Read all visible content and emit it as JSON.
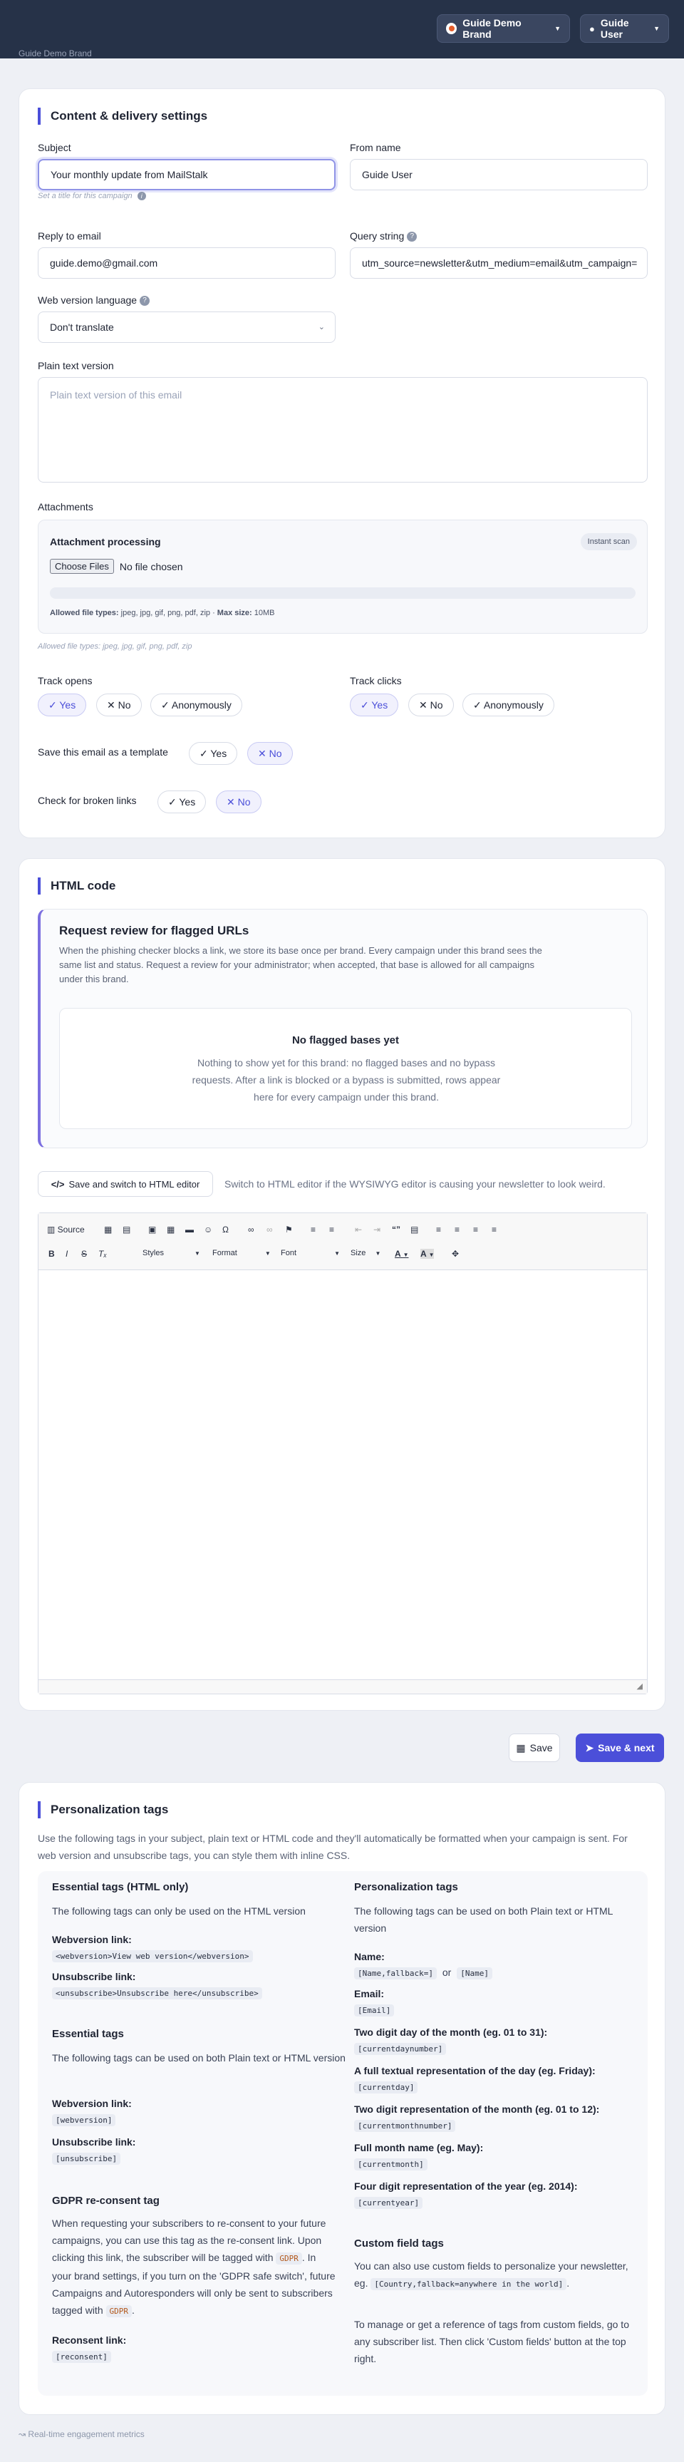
{
  "header": {
    "brand_button": "Guide Demo Brand",
    "user_button": "Guide User",
    "breadcrumb": "Guide Demo Brand"
  },
  "content_settings": {
    "title": "Content & delivery settings",
    "subject_label": "Subject",
    "subject_value": "Your monthly update from MailStalk",
    "subject_help": "Set a title for this campaign",
    "from_name_label": "From name",
    "from_name_value": "Guide User",
    "reply_to_label": "Reply to email",
    "reply_to_value": "guide.demo@gmail.com",
    "query_string_label": "Query string",
    "query_string_value": "utm_source=newsletter&utm_medium=email&utm_campaign=",
    "web_version_label": "Web version language",
    "web_version_value": "Don't translate",
    "plain_text_label": "Plain text version",
    "plain_text_placeholder": "Plain text version of this email",
    "attachments_label": "Attachments",
    "attachment_processing": "Attachment processing",
    "instant_scan": "Instant scan",
    "choose_files": "Choose Files",
    "no_file": "No file chosen",
    "allowed_types_bold": "Allowed file types:",
    "allowed_types": "jpeg, jpg, gif, png, pdf, zip",
    "max_size_bold": "Max size:",
    "max_size": "10MB",
    "allowed_help": "Allowed file types: jpeg, jpg, gif, png, pdf, zip",
    "track_opens_label": "Track opens",
    "track_clicks_label": "Track clicks",
    "yes": "Yes",
    "no": "No",
    "anonymously": "Anonymously",
    "save_template_label": "Save this email as a template",
    "broken_links_label": "Check for broken links"
  },
  "html_code": {
    "title": "HTML code",
    "review_title": "Request review for flagged URLs",
    "review_text": "When the phishing checker blocks a link, we store its base once per brand. Every campaign under this brand sees the same list and status. Request a review for your administrator; when accepted, that base is allowed for all campaigns under this brand.",
    "empty_title": "No flagged bases yet",
    "empty_text": "Nothing to show yet for this brand: no flagged bases and no bypass requests. After a link is blocked or a bypass is submitted, rows appear here for every campaign under this brand.",
    "switch_button": "Save and switch to HTML editor",
    "switch_help": "Switch to HTML editor if the WYSIWYG editor is causing your newsletter to look weird.",
    "toolbar_source": "Source",
    "styles": "Styles",
    "format": "Format",
    "font": "Font",
    "size": "Size"
  },
  "actions": {
    "save": "Save",
    "save_next": "Save & next"
  },
  "personalization": {
    "title": "Personalization tags",
    "intro": "Use the following tags in your subject, plain text or HTML code and they'll automatically be formatted when your campaign is sent. For web version and unsubscribe tags, you can style them with inline CSS.",
    "essential_html_title": "Essential tags (HTML only)",
    "essential_html_desc": "The following tags can only be used on the HTML version",
    "webversion_link_label": "Webversion link:",
    "webversion_html_code": "<webversion>View web version</webversion>",
    "unsubscribe_link_label": "Unsubscribe link:",
    "unsubscribe_html_code": "<unsubscribe>Unsubscribe here</unsubscribe>",
    "essential_title": "Essential tags",
    "essential_desc": "The following tags can be used on both Plain text or HTML version",
    "webversion_code": "[webversion]",
    "unsubscribe_code": "[unsubscribe]",
    "gdpr_title": "GDPR re-consent tag",
    "gdpr_text_1": "When requesting your subscribers to re-consent to your future campaigns, you can use this tag as the re-consent link. Upon clicking this link, the subscriber will be tagged with",
    "gdpr_code": "GDPR",
    "gdpr_text_2": ". In your brand settings, if you turn on the 'GDPR safe switch', future Campaigns and Autoresponders will only be sent to subscribers tagged with",
    "gdpr_text_3": ".",
    "reconsent_label": "Reconsent link:",
    "reconsent_code": "[reconsent]",
    "personal_title": "Personalization tags",
    "personal_desc": "The following tags can be used on both Plain text or HTML version",
    "name_label": "Name:",
    "name_code": "[Name,fallback=]",
    "or": "or",
    "name_code_2": "[Name]",
    "email_label": "Email:",
    "email_code": "[Email]",
    "day_label": "Two digit day of the month (eg. 01 to 31):",
    "day_code": "[currentdaynumber]",
    "dayname_label": "A full textual representation of the day (eg. Friday):",
    "dayname_code": "[currentday]",
    "month_label": "Two digit representation of the month (eg. 01 to 12):",
    "month_code": "[currentmonthnumber]",
    "monthname_label": "Full month name (eg. May):",
    "monthname_code": "[currentmonth]",
    "year_label": "Four digit representation of the year (eg. 2014):",
    "year_code": "[currentyear]",
    "custom_title": "Custom field tags",
    "custom_text_1": "You can also use custom fields to personalize your newsletter, eg.",
    "custom_code": "[Country,fallback=anywhere in the world]",
    "custom_text_2": ".",
    "custom_text_3": "To manage or get a reference of tags from custom fields, go to any subscriber list. Then click 'Custom fields' button at the top right."
  },
  "footer": {
    "link": "Real-time engagement metrics"
  },
  "colors": {
    "accent": "#4b4fd9",
    "topbar": "#263248",
    "background": "#eef0f5"
  }
}
